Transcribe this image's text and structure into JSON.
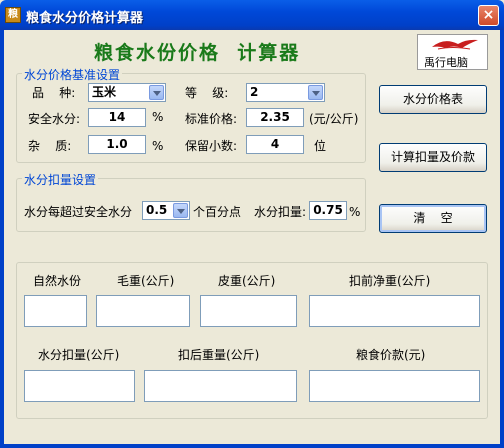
{
  "window": {
    "title": "粮食水分价格计算器",
    "icon_char": "粮",
    "close": "×"
  },
  "app_title": "粮食水份价格  计算器",
  "logo": {
    "text": "禹行电脑"
  },
  "standard_group": {
    "label": "水分价格基准设置",
    "variety_label": "品    种:",
    "variety_value": "玉米",
    "grade_label": "等    级:",
    "grade_value": "2",
    "safe_moisture_label": "安全水分:",
    "safe_moisture_value": "14",
    "safe_moisture_unit": "%",
    "std_price_label": "标准价格:",
    "std_price_value": "2.35",
    "std_price_unit": "(元/公斤)",
    "impurity_label": "杂    质:",
    "impurity_value": "1.0",
    "impurity_unit": "%",
    "decimals_label": "保留小数:",
    "decimals_value": "4",
    "decimals_unit": "位"
  },
  "deduction_group": {
    "label": "水分扣量设置",
    "over_label": "水分每超过安全水分",
    "over_value": "0.5",
    "over_unit": "个百分点",
    "deduct_label": "水分扣量:",
    "deduct_value": "0.75",
    "deduct_unit": "%"
  },
  "buttons": {
    "price_table": "水分价格表",
    "calculate": "计算扣量及价款",
    "clear": "清    空"
  },
  "results": {
    "natural_moisture": "自然水份",
    "gross_weight": "毛重(公斤)",
    "tare_weight": "皮重(公斤)",
    "net_before": "扣前净重(公斤)",
    "moisture_deduction": "水分扣量(公斤)",
    "weight_after": "扣后重量(公斤)",
    "grain_price": "粮食价款(元)"
  }
}
